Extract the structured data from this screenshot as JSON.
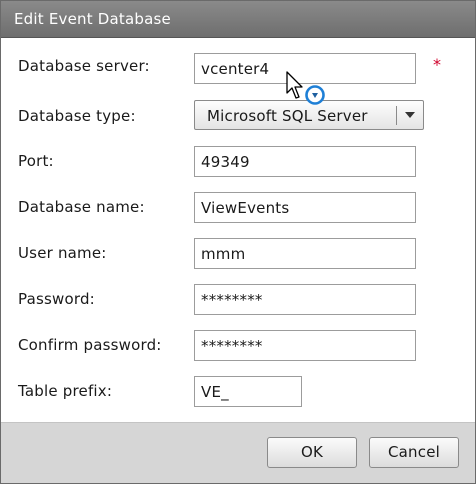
{
  "dialog": {
    "title": "Edit Event Database"
  },
  "form": {
    "server": {
      "label": "Database server:",
      "value": "vcenter4",
      "required_mark": "*"
    },
    "type": {
      "label": "Database type:",
      "value": "Microsoft SQL Server"
    },
    "port": {
      "label": "Port:",
      "value": "49349"
    },
    "dbname": {
      "label": "Database name:",
      "value": "ViewEvents"
    },
    "username": {
      "label": "User name:",
      "value": "mmm"
    },
    "password": {
      "label": "Password:",
      "value": "********"
    },
    "confirm": {
      "label": "Confirm password:",
      "value": "********"
    },
    "prefix": {
      "label": "Table prefix:",
      "value": "VE_"
    }
  },
  "buttons": {
    "ok": "OK",
    "cancel": "Cancel"
  },
  "icons": {
    "dropdown": "chevron-down-icon",
    "cursor": "pointer-cursor-icon",
    "busy": "busy-indicator-icon"
  },
  "colors": {
    "titlebar": "#7c7c7c",
    "required": "#d0002a",
    "busy_ring": "#1e7fd6"
  }
}
